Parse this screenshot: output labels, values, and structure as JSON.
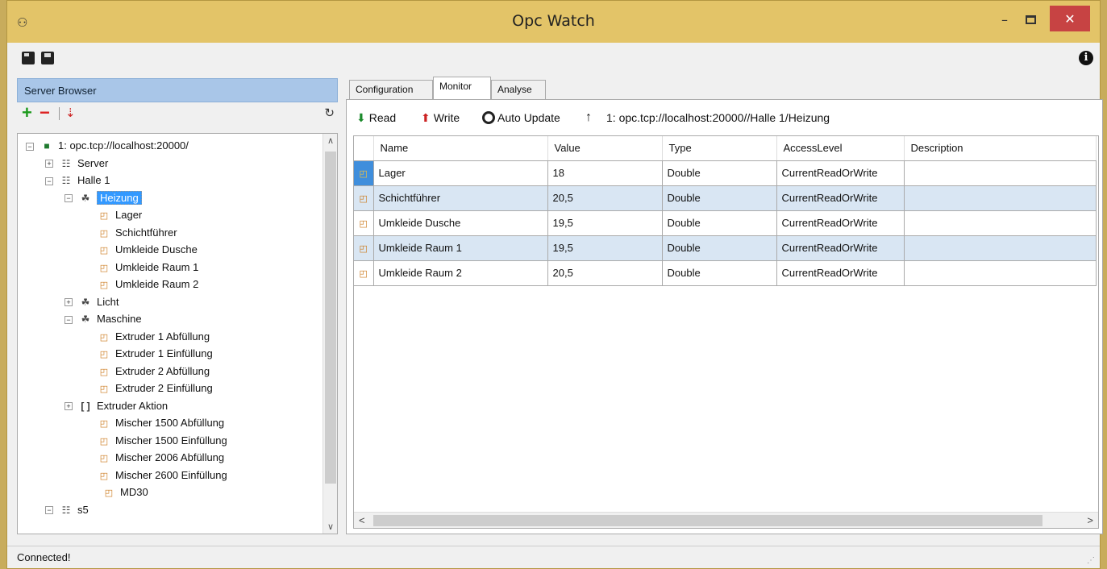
{
  "window": {
    "title": "Opc Watch"
  },
  "server_browser": {
    "header": "Server Browser",
    "tree": [
      {
        "level": 0,
        "label": "1: opc.tcp://localhost:20000/",
        "icon": "server-monitor-icon",
        "expander": "minus"
      },
      {
        "level": 1,
        "label": "Server",
        "icon": "network-node-icon",
        "expander": "plus"
      },
      {
        "level": 1,
        "label": "Halle 1",
        "icon": "network-node-icon",
        "expander": "minus"
      },
      {
        "level": 2,
        "label": "Heizung",
        "icon": "object-icon",
        "expander": "minus",
        "selected": true
      },
      {
        "level": 3,
        "label": "Lager",
        "icon": "variable-icon"
      },
      {
        "level": 3,
        "label": "Schichtführer",
        "icon": "variable-icon"
      },
      {
        "level": 3,
        "label": "Umkleide Dusche",
        "icon": "variable-icon"
      },
      {
        "level": 3,
        "label": "Umkleide Raum 1",
        "icon": "variable-icon"
      },
      {
        "level": 3,
        "label": "Umkleide Raum 2",
        "icon": "variable-icon"
      },
      {
        "level": 2,
        "label": "Licht",
        "icon": "object-icon",
        "expander": "plus"
      },
      {
        "level": 2,
        "label": "Maschine",
        "icon": "object-icon",
        "expander": "minus"
      },
      {
        "level": 3,
        "label": "Extruder 1 Abfüllung",
        "icon": "variable-icon"
      },
      {
        "level": 3,
        "label": "Extruder 1 Einfüllung",
        "icon": "variable-icon"
      },
      {
        "level": 3,
        "label": "Extruder 2 Abfüllung",
        "icon": "variable-icon"
      },
      {
        "level": 3,
        "label": "Extruder 2 Einfüllung",
        "icon": "variable-icon"
      },
      {
        "level": 3,
        "label": "Extruder Aktion",
        "icon": "method-icon",
        "expander": "plus",
        "expander_level": 2
      },
      {
        "level": 3,
        "label": "Mischer 1500 Abfüllung",
        "icon": "variable-icon"
      },
      {
        "level": 3,
        "label": "Mischer 1500 Einfüllung",
        "icon": "variable-icon"
      },
      {
        "level": 3,
        "label": "Mischer 2006 Abfüllung",
        "icon": "variable-icon"
      },
      {
        "level": 3,
        "label": "Mischer 2600 Einfüllung",
        "icon": "variable-icon"
      },
      {
        "level": 2,
        "label": "MD30",
        "icon": "variable-icon",
        "offset": 46
      },
      {
        "level": 1,
        "label": "s5",
        "icon": "network-node-icon",
        "expander": "minus"
      }
    ]
  },
  "tabs": [
    "Configuration",
    "Monitor",
    "Analyse"
  ],
  "monitor": {
    "read_label": "Read",
    "write_label": "Write",
    "auto_update_label": "Auto Update",
    "path": "1: opc.tcp://localhost:20000//Halle 1/Heizung",
    "columns": [
      "Name",
      "Value",
      "Type",
      "AccessLevel",
      "Description"
    ],
    "rows": [
      [
        "Lager",
        "18",
        "Double",
        "CurrentReadOrWrite",
        ""
      ],
      [
        "Schichtführer",
        "20,5",
        "Double",
        "CurrentReadOrWrite",
        ""
      ],
      [
        "Umkleide Dusche",
        "19,5",
        "Double",
        "CurrentReadOrWrite",
        ""
      ],
      [
        "Umkleide Raum 1",
        "19,5",
        "Double",
        "CurrentReadOrWrite",
        ""
      ],
      [
        "Umkleide Raum 2",
        "20,5",
        "Double",
        "CurrentReadOrWrite",
        ""
      ]
    ]
  },
  "status": "Connected!"
}
